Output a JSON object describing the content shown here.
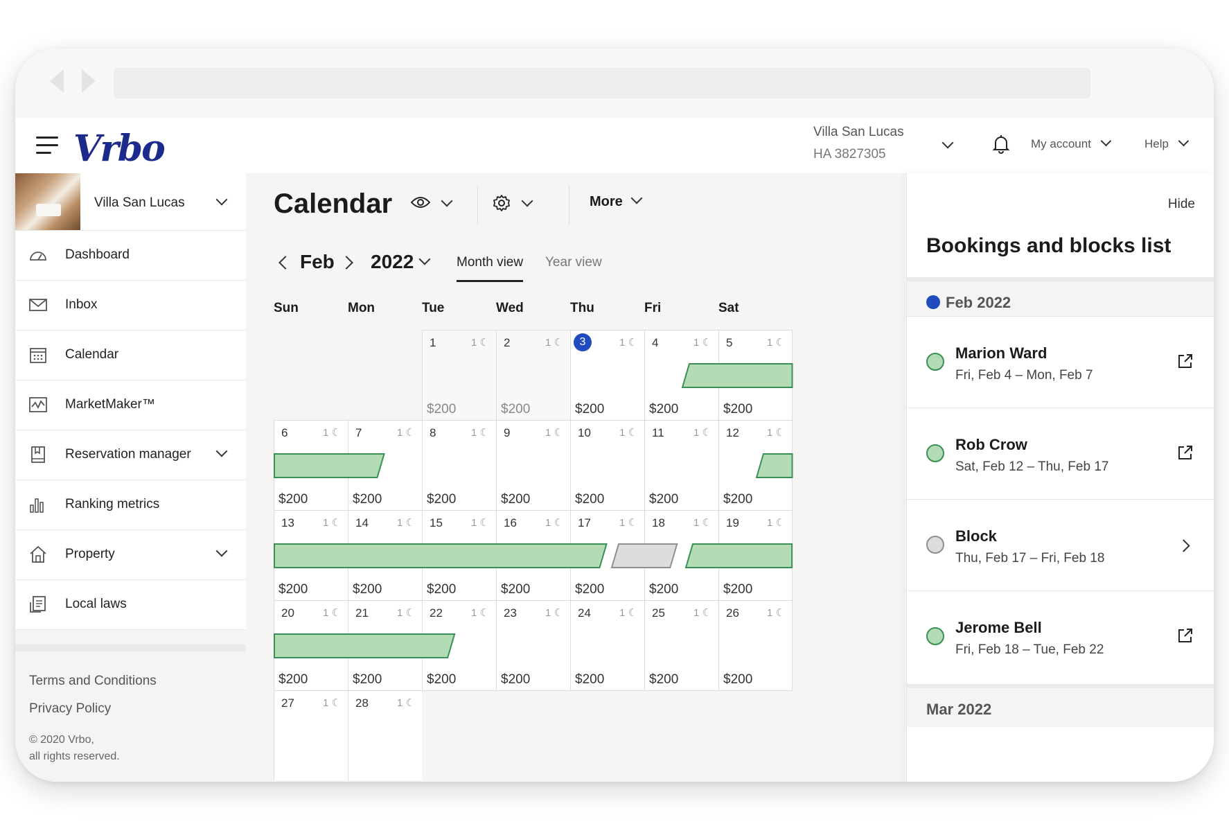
{
  "header": {
    "logo_text": "Vrbo",
    "property_name": "Villa San Lucas",
    "property_id": "HA 3827305",
    "account_label": "My account",
    "help_label": "Help"
  },
  "sidebar": {
    "property_name": "Villa San Lucas",
    "items": [
      {
        "label": "Dashboard",
        "icon": "gauge-icon"
      },
      {
        "label": "Inbox",
        "icon": "envelope-icon"
      },
      {
        "label": "Calendar",
        "icon": "calendar-icon"
      },
      {
        "label": "MarketMaker™",
        "icon": "chart-line-icon"
      },
      {
        "label": "Reservation manager",
        "icon": "book-icon"
      },
      {
        "label": "Ranking metrics",
        "icon": "bar-chart-icon"
      },
      {
        "label": "Property",
        "icon": "house-icon"
      },
      {
        "label": "Local laws",
        "icon": "document-icon"
      }
    ],
    "footer": {
      "terms": "Terms and Conditions",
      "privacy": "Privacy Policy",
      "copyright_line1": "© 2020 Vrbo,",
      "copyright_line2": "all rights reserved."
    }
  },
  "calendar": {
    "title": "Calendar",
    "more_label": "More",
    "month": "Feb",
    "year": "2022",
    "month_view": "Month view",
    "year_view": "Year view",
    "weekdays": [
      "Sun",
      "Mon",
      "Tue",
      "Wed",
      "Thu",
      "Fri",
      "Sat"
    ],
    "today": 3,
    "min_nights": "1",
    "weeks": [
      [
        null,
        null,
        {
          "d": "1",
          "p": "$200",
          "past": true
        },
        {
          "d": "2",
          "p": "$200",
          "past": true
        },
        {
          "d": "3",
          "p": "$200"
        },
        {
          "d": "4",
          "p": "$200"
        },
        {
          "d": "5",
          "p": "$200"
        }
      ],
      [
        {
          "d": "6",
          "p": "$200"
        },
        {
          "d": "7",
          "p": "$200"
        },
        {
          "d": "8",
          "p": "$200"
        },
        {
          "d": "9",
          "p": "$200"
        },
        {
          "d": "10",
          "p": "$200"
        },
        {
          "d": "11",
          "p": "$200"
        },
        {
          "d": "12",
          "p": "$200"
        }
      ],
      [
        {
          "d": "13",
          "p": "$200"
        },
        {
          "d": "14",
          "p": "$200"
        },
        {
          "d": "15",
          "p": "$200"
        },
        {
          "d": "16",
          "p": "$200"
        },
        {
          "d": "17",
          "p": "$200"
        },
        {
          "d": "18",
          "p": "$200"
        },
        {
          "d": "19",
          "p": "$200"
        }
      ],
      [
        {
          "d": "20",
          "p": "$200"
        },
        {
          "d": "21",
          "p": "$200"
        },
        {
          "d": "22",
          "p": "$200"
        },
        {
          "d": "23",
          "p": "$200"
        },
        {
          "d": "24",
          "p": "$200"
        },
        {
          "d": "25",
          "p": "$200"
        },
        {
          "d": "26",
          "p": "$200"
        }
      ],
      [
        {
          "d": "27",
          "p": ""
        },
        {
          "d": "28",
          "p": ""
        },
        null,
        null,
        null,
        null,
        null
      ]
    ],
    "bars": [
      {
        "type": "booking",
        "week": 0,
        "start_col": 5.5,
        "end_col": 7.0,
        "open_left": false,
        "open_right": true
      },
      {
        "type": "booking",
        "week": 1,
        "start_col": 0.0,
        "end_col": 1.5,
        "open_left": true,
        "open_right": false
      },
      {
        "type": "booking",
        "week": 1,
        "start_col": 6.5,
        "end_col": 7.0,
        "open_left": false,
        "open_right": true
      },
      {
        "type": "booking",
        "week": 2,
        "start_col": 0.0,
        "end_col": 4.5,
        "open_left": true,
        "open_right": false
      },
      {
        "type": "block",
        "week": 2,
        "start_col": 4.55,
        "end_col": 5.45,
        "open_left": false,
        "open_right": false
      },
      {
        "type": "booking",
        "week": 2,
        "start_col": 5.55,
        "end_col": 7.0,
        "open_left": false,
        "open_right": true
      },
      {
        "type": "booking",
        "week": 3,
        "start_col": 0.0,
        "end_col": 2.45,
        "open_left": true,
        "open_right": false
      }
    ]
  },
  "bookings_panel": {
    "hide_label": "Hide",
    "title": "Bookings and blocks list",
    "month_header": "Feb 2022",
    "next_month_header": "Mar 2022",
    "accent": "#1f4bbf",
    "items": [
      {
        "name": "Marion Ward",
        "dates": "Fri, Feb 4 – Mon, Feb 7",
        "status": "green",
        "action": "external-link-icon"
      },
      {
        "name": "Rob Crow",
        "dates": "Sat, Feb 12 – Thu, Feb 17",
        "status": "green",
        "action": "external-link-icon"
      },
      {
        "name": "Block",
        "dates": "Thu, Feb 17 – Fri, Feb 18",
        "status": "gray",
        "action": "chevron-right-icon"
      },
      {
        "name": "Jerome Bell",
        "dates": "Fri, Feb 18 – Tue, Feb 22",
        "status": "green",
        "action": "external-link-icon"
      }
    ]
  }
}
